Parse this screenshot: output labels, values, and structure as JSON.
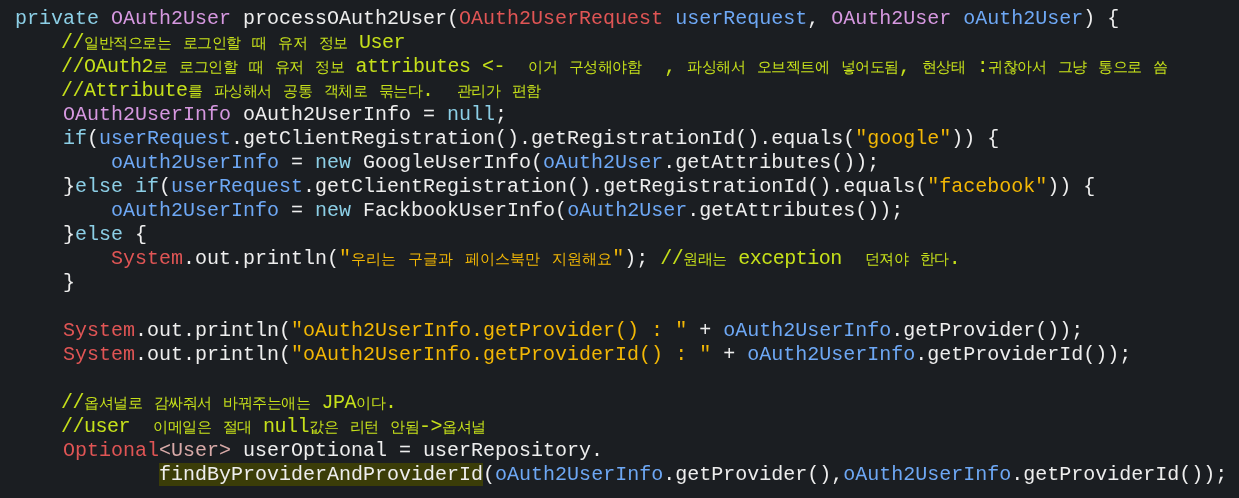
{
  "editor": {
    "lines": [
      {
        "kind": "code",
        "tokens": [
          {
            "text": "private",
            "kind": "kw"
          },
          {
            "text": " OAuth2User",
            "kind": "type"
          },
          {
            "text": " processOAuth2User(",
            "kind": "plain"
          },
          {
            "text": "OAuth2UserRequest",
            "kind": "cls"
          },
          {
            "text": " userRequest",
            "kind": "var"
          },
          {
            "text": ", ",
            "kind": "plain"
          },
          {
            "text": "OAuth2User",
            "kind": "type"
          },
          {
            "text": " oAuth2User",
            "kind": "var"
          },
          {
            "text": ") {",
            "kind": "plain"
          }
        ]
      },
      {
        "kind": "code",
        "tokens": [
          {
            "text": "    //일반적으로는 로그인할 때 유저 정보 User",
            "kind": "com"
          }
        ]
      },
      {
        "kind": "code",
        "tokens": [
          {
            "text": "    //OAuth2로 로그인할 때 유저 정보 attributes <-  이거 구성해야함  , 파싱해서 오브젝트에 넣어도됨, 현상태 :귀찮아서 그냥 통으로 씀",
            "kind": "com"
          }
        ]
      },
      {
        "kind": "code",
        "tokens": [
          {
            "text": "    //Attribute를 파싱해서 공통 객체로 묶는다.  관리가 편함",
            "kind": "com"
          }
        ]
      },
      {
        "kind": "code",
        "tokens": [
          {
            "text": "    OAuth2UserInfo",
            "kind": "type"
          },
          {
            "text": " oAuth2UserInfo = ",
            "kind": "plain"
          },
          {
            "text": "null",
            "kind": "kw"
          },
          {
            "text": ";",
            "kind": "plain"
          }
        ]
      },
      {
        "kind": "code",
        "tokens": [
          {
            "text": "    if",
            "kind": "kw"
          },
          {
            "text": "(",
            "kind": "plain"
          },
          {
            "text": "userRequest",
            "kind": "var"
          },
          {
            "text": ".getClientRegistration().getRegistrationId().equals(",
            "kind": "plain"
          },
          {
            "text": "\"google\"",
            "kind": "str"
          },
          {
            "text": ")) {",
            "kind": "plain"
          }
        ]
      },
      {
        "kind": "code",
        "tokens": [
          {
            "text": "        oAuth2UserInfo",
            "kind": "var"
          },
          {
            "text": " = ",
            "kind": "plain"
          },
          {
            "text": "new",
            "kind": "kw"
          },
          {
            "text": " GoogleUserInfo(",
            "kind": "plain"
          },
          {
            "text": "oAuth2User",
            "kind": "var"
          },
          {
            "text": ".getAttributes());",
            "kind": "plain"
          }
        ]
      },
      {
        "kind": "code",
        "tokens": [
          {
            "text": "    }",
            "kind": "plain"
          },
          {
            "text": "else if",
            "kind": "kw"
          },
          {
            "text": "(",
            "kind": "plain"
          },
          {
            "text": "userRequest",
            "kind": "var"
          },
          {
            "text": ".getClientRegistration().getRegistrationId().equals(",
            "kind": "plain"
          },
          {
            "text": "\"facebook\"",
            "kind": "str"
          },
          {
            "text": ")) {",
            "kind": "plain"
          }
        ]
      },
      {
        "kind": "code",
        "tokens": [
          {
            "text": "        oAuth2UserInfo",
            "kind": "var"
          },
          {
            "text": " = ",
            "kind": "plain"
          },
          {
            "text": "new",
            "kind": "kw"
          },
          {
            "text": " FackbookUserInfo(",
            "kind": "plain"
          },
          {
            "text": "oAuth2User",
            "kind": "var"
          },
          {
            "text": ".getAttributes());",
            "kind": "plain"
          }
        ]
      },
      {
        "kind": "code",
        "tokens": [
          {
            "text": "    }",
            "kind": "plain"
          },
          {
            "text": "else",
            "kind": "kw"
          },
          {
            "text": " {",
            "kind": "plain"
          }
        ]
      },
      {
        "kind": "code",
        "tokens": [
          {
            "text": "        System",
            "kind": "cls"
          },
          {
            "text": ".out.println(",
            "kind": "plain"
          },
          {
            "text": "\"우리는 구글과 페이스북만 지원해요\"",
            "kind": "str"
          },
          {
            "text": "); ",
            "kind": "plain"
          },
          {
            "text": "//원래는 exception  던져야 한다.",
            "kind": "com"
          }
        ]
      },
      {
        "kind": "code",
        "tokens": [
          {
            "text": "    }",
            "kind": "plain"
          }
        ]
      },
      {
        "kind": "blank"
      },
      {
        "kind": "code",
        "tokens": [
          {
            "text": "    System",
            "kind": "cls"
          },
          {
            "text": ".out.println(",
            "kind": "plain"
          },
          {
            "text": "\"oAuth2UserInfo.getProvider() : \"",
            "kind": "str"
          },
          {
            "text": " + ",
            "kind": "plain"
          },
          {
            "text": "oAuth2UserInfo",
            "kind": "var"
          },
          {
            "text": ".getProvider());",
            "kind": "plain"
          }
        ]
      },
      {
        "kind": "code",
        "tokens": [
          {
            "text": "    System",
            "kind": "cls"
          },
          {
            "text": ".out.println(",
            "kind": "plain"
          },
          {
            "text": "\"oAuth2UserInfo.getProviderId() : \"",
            "kind": "str"
          },
          {
            "text": " + ",
            "kind": "plain"
          },
          {
            "text": "oAuth2UserInfo",
            "kind": "var"
          },
          {
            "text": ".getProviderId());",
            "kind": "plain"
          }
        ]
      },
      {
        "kind": "blank"
      },
      {
        "kind": "code",
        "tokens": [
          {
            "text": "    //옵셔널로 감싸줘서 바꿔주는애는 JPA이다.",
            "kind": "com"
          }
        ]
      },
      {
        "kind": "code",
        "tokens": [
          {
            "text": "    //user  이메일은 절대 null값은 리턴 안됨->옵셔널",
            "kind": "com"
          }
        ]
      },
      {
        "kind": "code",
        "tokens": [
          {
            "text": "    Optional",
            "kind": "cls"
          },
          {
            "text": "<User>",
            "kind": "generic"
          },
          {
            "text": " userOptional = userRepository.",
            "kind": "plain"
          }
        ]
      },
      {
        "kind": "code",
        "tokens": [
          {
            "text": "            findByProviderAndProviderId",
            "kind": "plain",
            "highlighted": true
          },
          {
            "text": "(",
            "kind": "plain"
          },
          {
            "text": "oAuth2UserInfo",
            "kind": "var"
          },
          {
            "text": ".getProvider(),",
            "kind": "plain"
          },
          {
            "text": "oAuth2UserInfo",
            "kind": "var"
          },
          {
            "text": ".getProviderId());",
            "kind": "plain"
          }
        ]
      }
    ]
  }
}
